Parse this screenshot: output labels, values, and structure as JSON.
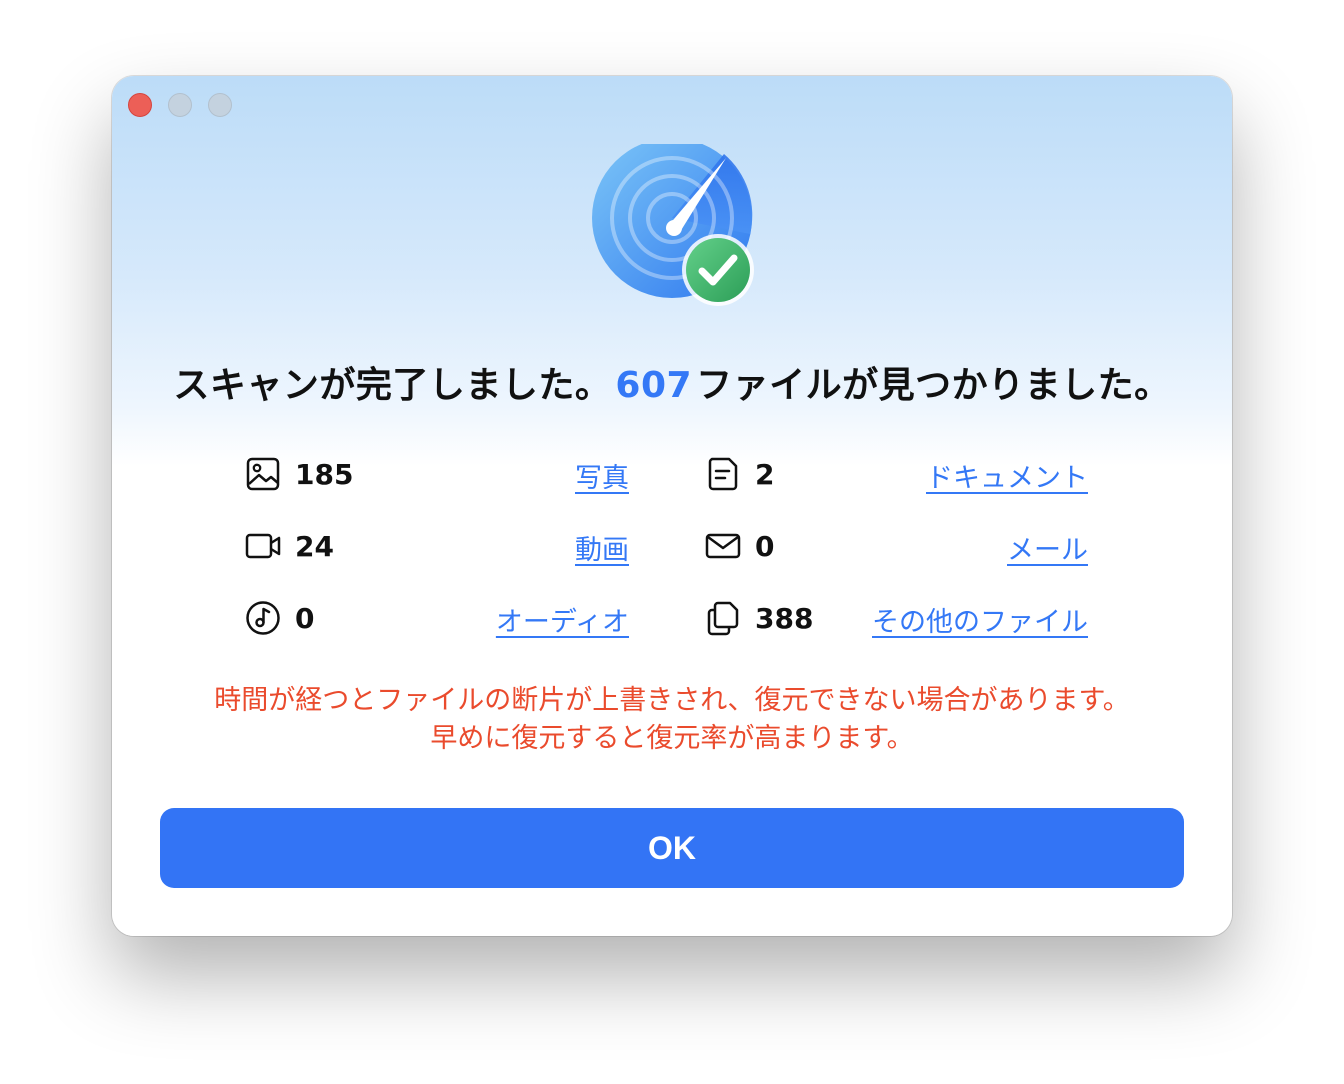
{
  "window": {
    "controls": [
      "close",
      "minimize",
      "zoom"
    ]
  },
  "icon": {
    "name": "scan-complete-gauge-check-icon"
  },
  "headline": {
    "prefix": "スキャンが完了しました。",
    "count": "607",
    "suffix": "ファイルが見つかりました。"
  },
  "stats": [
    {
      "icon": "photo-icon",
      "count": "185",
      "label": "写真"
    },
    {
      "icon": "document-icon",
      "count": "2",
      "label": "ドキュメント"
    },
    {
      "icon": "video-icon",
      "count": "24",
      "label": "動画"
    },
    {
      "icon": "mail-icon",
      "count": "0",
      "label": "メール"
    },
    {
      "icon": "audio-icon",
      "count": "0",
      "label": "オーディオ"
    },
    {
      "icon": "other-files-icon",
      "count": "388",
      "label": "その他のファイル"
    }
  ],
  "warning": {
    "line1": "時間が経つとファイルの断片が上書きされ、復元できない場合があります。",
    "line2": "早めに復元すると復元率が高まります。"
  },
  "ok_button": {
    "label": "OK"
  },
  "colors": {
    "accent": "#3374f5",
    "warning": "#ea4b2d",
    "close": "#ec5f57",
    "success": "#3fb86a"
  }
}
